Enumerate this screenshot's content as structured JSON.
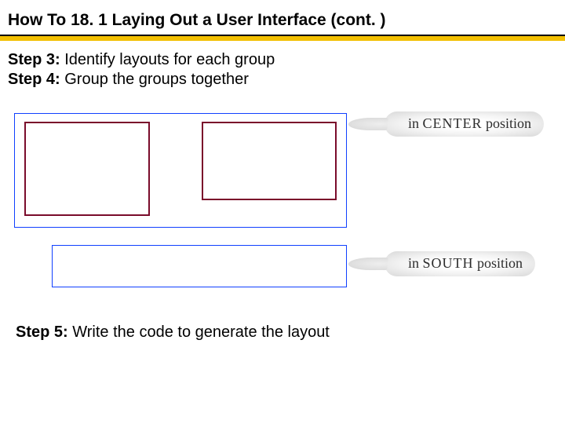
{
  "title": "How To 18. 1 Laying Out a User Interface  (cont. )",
  "step3": {
    "label": "Step 3: ",
    "text": "Identify layouts for each group"
  },
  "step4": {
    "label": "Step 4: ",
    "text": "Group the groups together"
  },
  "callouts": {
    "center_prefix": "in ",
    "center_word": "CENTER",
    "center_suffix": " position",
    "south_prefix": "in ",
    "south_word": "SOUTH",
    "south_suffix": " position"
  },
  "step5": {
    "label": "Step 5: ",
    "text": "Write the code to generate the layout"
  }
}
